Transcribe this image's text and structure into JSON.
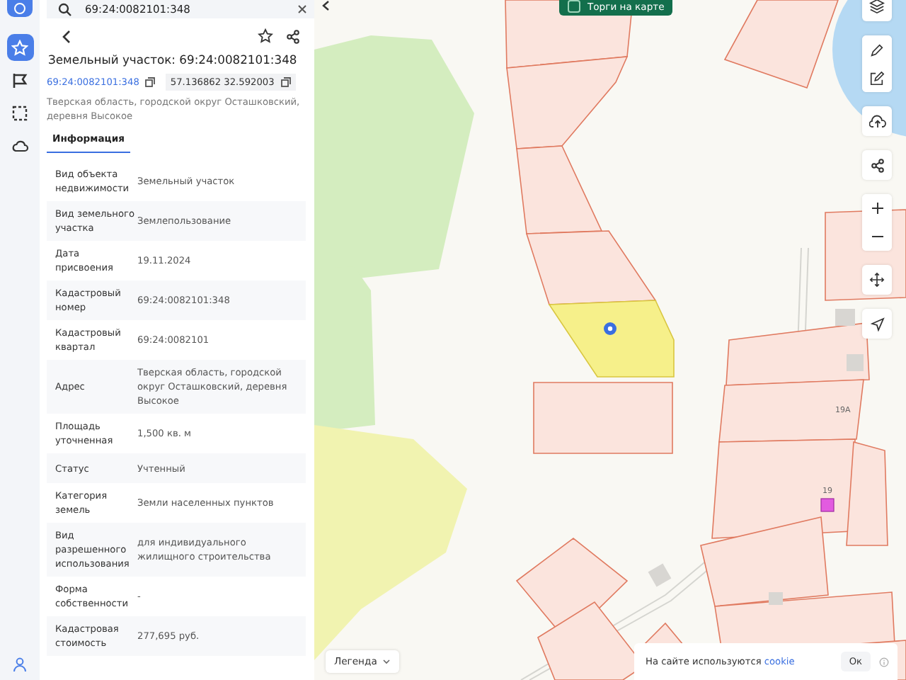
{
  "sidebar": {
    "items": [
      {
        "kind": "star",
        "selected": true
      },
      {
        "kind": "flag",
        "selected": false
      },
      {
        "kind": "area",
        "selected": false
      },
      {
        "kind": "cloud",
        "selected": false
      }
    ]
  },
  "search": {
    "value": "69:24:0082101:348"
  },
  "card": {
    "title": "Земельный участок: 69:24:0082101:348",
    "cadastral_link": "69:24:0082101:348",
    "coordinates": "57.136862 32.592003",
    "address": "Тверская область, городской округ Осташковский, деревня Высокое",
    "tabs": [
      {
        "label": "Информация",
        "selected": true
      }
    ],
    "rows": [
      {
        "label": "Вид объекта недвижимости",
        "value": "Земельный участок"
      },
      {
        "label": "Вид земельного участка",
        "value": "Землепользование"
      },
      {
        "label": "Дата присвоения",
        "value": "19.11.2024"
      },
      {
        "label": "Кадастровый номер",
        "value": "69:24:0082101:348"
      },
      {
        "label": "Кадастровый квартал",
        "value": "69:24:0082101"
      },
      {
        "label": "Адрес",
        "value": "Тверская область, городской округ Осташковский, деревня Высокое"
      },
      {
        "label": "Площадь уточненная",
        "value": "1,500 кв. м"
      },
      {
        "label": "Статус",
        "value": "Учтенный"
      },
      {
        "label": "Категория земель",
        "value": "Земли населенных пунктов"
      },
      {
        "label": "Вид разрешенного использования",
        "value": "для индивидуального жилищного строительства"
      },
      {
        "label": "Форма собственности",
        "value": "-"
      },
      {
        "label": "Кадастровая стоимость",
        "value": "277,695 руб."
      }
    ]
  },
  "map": {
    "auction_toggle": {
      "label": "Торги на карте",
      "checked": false
    },
    "house_numbers": [
      "19А",
      "19"
    ],
    "legend_button": "Легенда",
    "cookie": {
      "text": "На сайте используются",
      "link": "cookie",
      "button": "Ок"
    }
  }
}
